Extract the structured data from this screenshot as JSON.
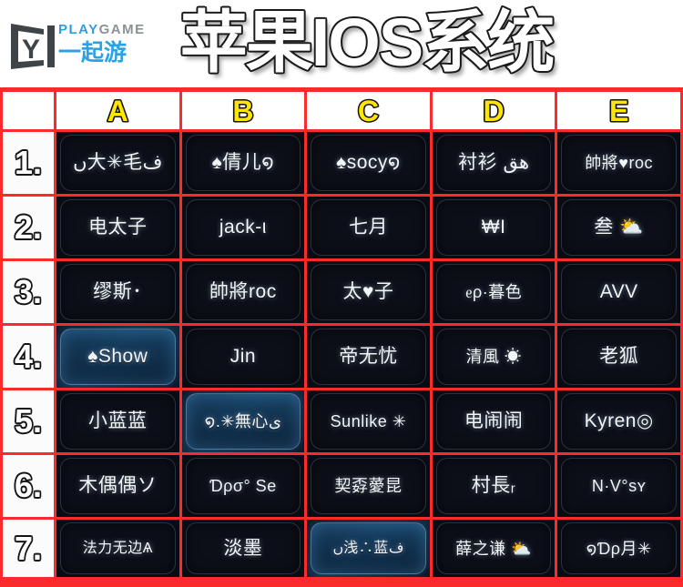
{
  "header": {
    "title": "苹果IOS系统",
    "logo": {
      "mark": "y-monitor-logo",
      "play": "PLAY",
      "game": "GAME",
      "cn": "一起游"
    }
  },
  "grid": {
    "corner_label": "",
    "columns": [
      "A",
      "B",
      "C",
      "D",
      "E"
    ],
    "row_labels": [
      "1.",
      "2.",
      "3.",
      "4.",
      "5.",
      "6.",
      "7."
    ],
    "colors": {
      "grid_line": "#fc2b2b",
      "header_letter": "#ffe600",
      "header_letter_outline": "#101010",
      "cell_background": "#0a0c14",
      "cell_text": "#f2f5f8",
      "highlight_glow": "#2f7fc0",
      "logo_play": "#2f9ee0",
      "logo_game": "#8c9196",
      "logo_cn": "#2aa3e6"
    },
    "rows": [
      {
        "label": "1.",
        "cells": [
          {
            "text": "ں大✳毛ف",
            "highlight": false,
            "size": "normal"
          },
          {
            "text": "♠倩儿໑",
            "highlight": false,
            "size": "normal"
          },
          {
            "text": "♠socy໑",
            "highlight": false,
            "size": "normal"
          },
          {
            "text": "衬衫  ھق",
            "highlight": false,
            "size": "normal"
          },
          {
            "text": "帥將♥roc",
            "highlight": false,
            "size": "sm"
          }
        ]
      },
      {
        "label": "2.",
        "cells": [
          {
            "text": "电太子",
            "highlight": false,
            "size": "normal"
          },
          {
            "text": "jack-ι",
            "highlight": false,
            "size": "normal"
          },
          {
            "text": "七月",
            "highlight": false,
            "size": "normal"
          },
          {
            "text": "₩I",
            "highlight": false,
            "size": "normal"
          },
          {
            "text": "叁 ⛅",
            "highlight": false,
            "size": "normal"
          }
        ]
      },
      {
        "label": "3.",
        "cells": [
          {
            "text": "缪斯･",
            "highlight": false,
            "size": "normal"
          },
          {
            "text": "帥將roc",
            "highlight": false,
            "size": "normal"
          },
          {
            "text": "太♥子",
            "highlight": false,
            "size": "normal"
          },
          {
            "text": "ᧉρ·暮色",
            "highlight": false,
            "size": "sm"
          },
          {
            "text": "AVV",
            "highlight": false,
            "size": "normal"
          }
        ]
      },
      {
        "label": "4.",
        "cells": [
          {
            "text": "♠Show",
            "highlight": true,
            "size": "normal"
          },
          {
            "text": "Jin",
            "highlight": false,
            "size": "normal"
          },
          {
            "text": "帝无忧",
            "highlight": false,
            "size": "normal"
          },
          {
            "text": "清風 ☀",
            "highlight": false,
            "size": "sm"
          },
          {
            "text": "老狐",
            "highlight": false,
            "size": "normal"
          }
        ]
      },
      {
        "label": "5.",
        "cells": [
          {
            "text": "小蓝蓝",
            "highlight": false,
            "size": "normal"
          },
          {
            "text": "໑.✳無心ى",
            "highlight": true,
            "size": "sm"
          },
          {
            "text": "Sunlike ✳",
            "highlight": false,
            "size": "sm"
          },
          {
            "text": "电闹闹",
            "highlight": false,
            "size": "normal"
          },
          {
            "text": "Kyren◎",
            "highlight": false,
            "size": "normal"
          }
        ]
      },
      {
        "label": "6.",
        "cells": [
          {
            "text": "木偶偶ソ",
            "highlight": false,
            "size": "normal"
          },
          {
            "text": "Ɗρσ°  Se",
            "highlight": false,
            "size": "sm"
          },
          {
            "text": "契孬薆昆",
            "highlight": false,
            "size": "sm"
          },
          {
            "text": "村長ᵣ",
            "highlight": false,
            "size": "normal"
          },
          {
            "text": "Ν·V°sʏ",
            "highlight": false,
            "size": "sm"
          }
        ]
      },
      {
        "label": "7.",
        "cells": [
          {
            "text": "法力无边Ѧ",
            "highlight": false,
            "size": "xs"
          },
          {
            "text": "淡墨",
            "highlight": false,
            "size": "normal"
          },
          {
            "text": "ں浅∴蓝ف",
            "highlight": true,
            "size": "xs"
          },
          {
            "text": "薛之谦 ⛅",
            "highlight": false,
            "size": "sm"
          },
          {
            "text": "໑Ɗρ月✳",
            "highlight": false,
            "size": "sm"
          }
        ]
      }
    ]
  }
}
